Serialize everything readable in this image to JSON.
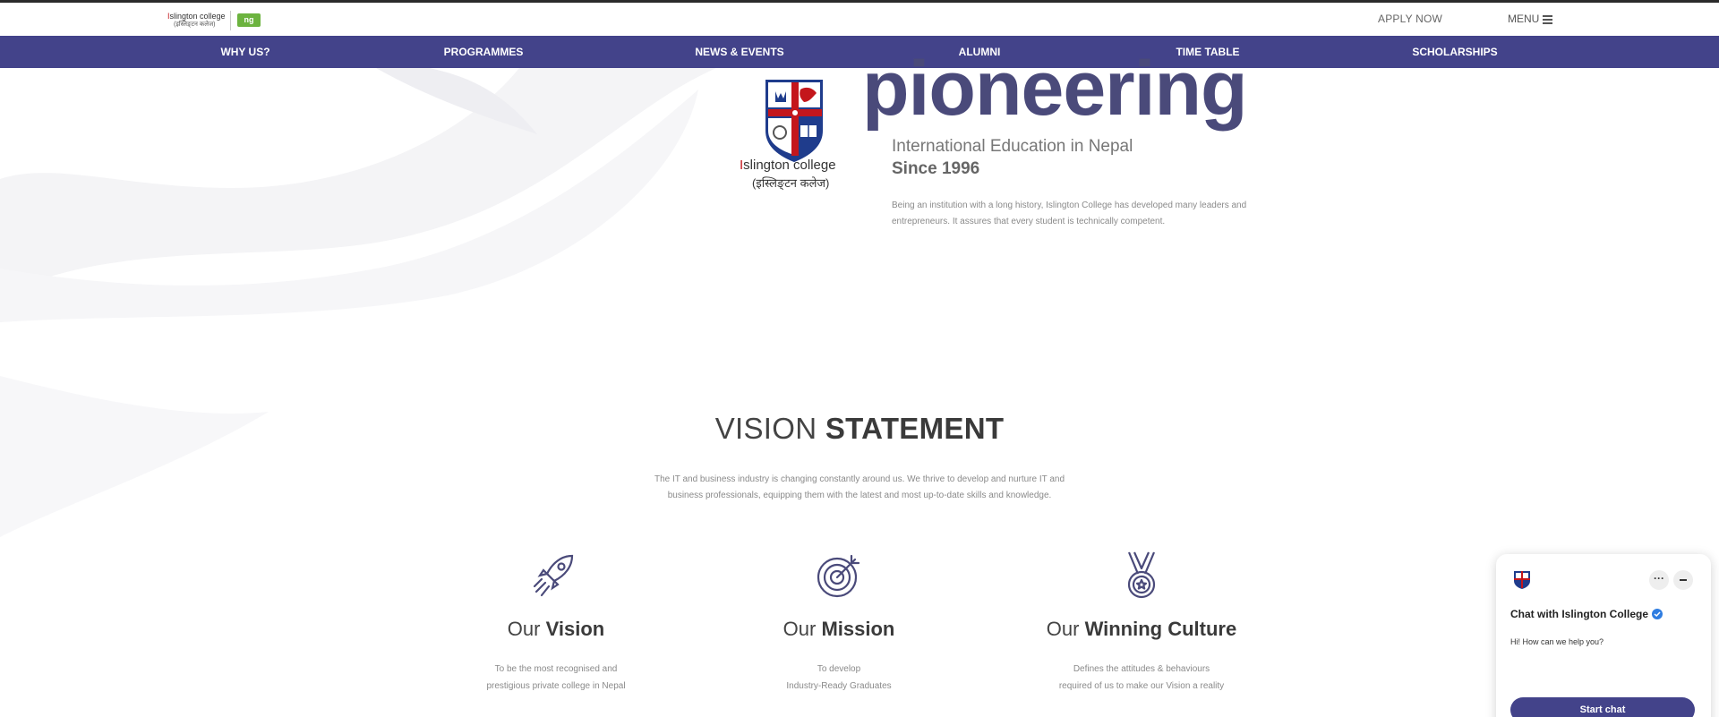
{
  "header": {
    "logo_text_a": "I",
    "logo_text_b": "slington college",
    "logo_text_devanagari": "(इस्लिङ्टन कलेज)",
    "logo_badge": "ng",
    "apply_label": "APPLY NOW",
    "menu_label": "MENU"
  },
  "nav": {
    "items": [
      {
        "label": "WHY US?"
      },
      {
        "label": "PROGRAMMES"
      },
      {
        "label": "NEWS & EVENTS"
      },
      {
        "label": "ALUMNI"
      },
      {
        "label": "TIME TABLE"
      },
      {
        "label": "SCHOLARSHIPS"
      }
    ]
  },
  "hero": {
    "crest_caption_a": "I",
    "crest_caption_b": "slington college",
    "crest_caption_devanagari": "(इस्लिङ्टन कलेज)",
    "headline": "pioneering",
    "subtitle": "International Education in Nepal",
    "since": "Since 1996",
    "description": "Being an institution with a long history, Islington College has developed many leaders and entrepreneurs. It assures that every student is technically competent."
  },
  "vision": {
    "title_light": "VISION",
    "title_bold": "STATEMENT",
    "description": "The IT and business industry is changing constantly around us. We thrive to develop and nurture IT and business professionals, equipping them with the latest and most up-to-date skills and knowledge.",
    "columns": [
      {
        "title_light": "Our",
        "title_bold": "Vision",
        "line1": "To be the most recognised and",
        "line2": "prestigious private college in Nepal",
        "icon": "rocket-icon"
      },
      {
        "title_light": "Our",
        "title_bold": "Mission",
        "line1": "To develop",
        "line2": "Industry-Ready Graduates",
        "icon": "target-icon"
      },
      {
        "title_light": "Our",
        "title_bold": "Winning Culture",
        "line1": "Defines the attitudes & behaviours",
        "line2": "required of us to make our Vision a reality",
        "icon": "medal-icon"
      }
    ]
  },
  "chat": {
    "title": "Chat with Islington College",
    "message": "Hi! How can we help you?",
    "dots_label": "···",
    "start_label": "Start chat"
  },
  "colors": {
    "brand_navy": "#43438a",
    "headline": "#4a4a7a",
    "brand_red": "#c4161c",
    "badge_green": "#6cb33f"
  }
}
